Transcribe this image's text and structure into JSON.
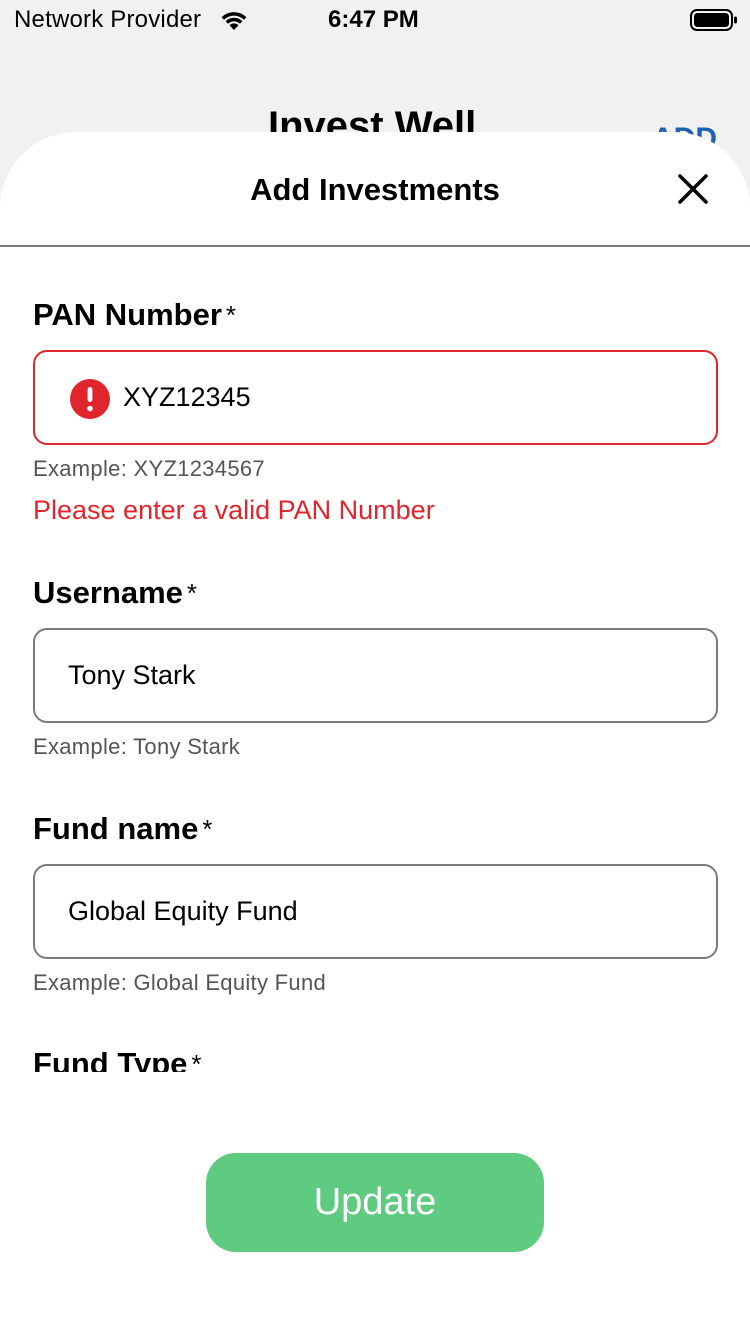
{
  "status_bar": {
    "carrier": "Network Provider",
    "time": "6:47 PM",
    "wifi_icon": "wifi-icon",
    "battery_icon": "battery-icon"
  },
  "background": {
    "title": "Invest Well",
    "right_text": "ADD"
  },
  "sheet": {
    "title": "Add Investments",
    "close_icon": "close-icon"
  },
  "form": {
    "pan": {
      "label": "PAN Number",
      "required_mark": "*",
      "value": "XYZ12345",
      "hint": "Example: XYZ1234567",
      "error": "Please enter a valid PAN Number",
      "error_icon": "exclamation-circle-icon"
    },
    "username": {
      "label": "Username",
      "required_mark": "*",
      "value": "Tony Stark",
      "hint": "Example: Tony Stark"
    },
    "fund_name": {
      "label": "Fund name",
      "required_mark": "*",
      "value": "Global Equity Fund",
      "hint": "Example: Global Equity Fund"
    },
    "fund_type": {
      "label": "Fund Type",
      "required_mark": "*"
    }
  },
  "actions": {
    "update_label": "Update"
  },
  "colors": {
    "error": "#e0262c",
    "primary_button": "#5ecb80",
    "border": "#7b7b7b",
    "link_blue": "#1d63b0"
  }
}
